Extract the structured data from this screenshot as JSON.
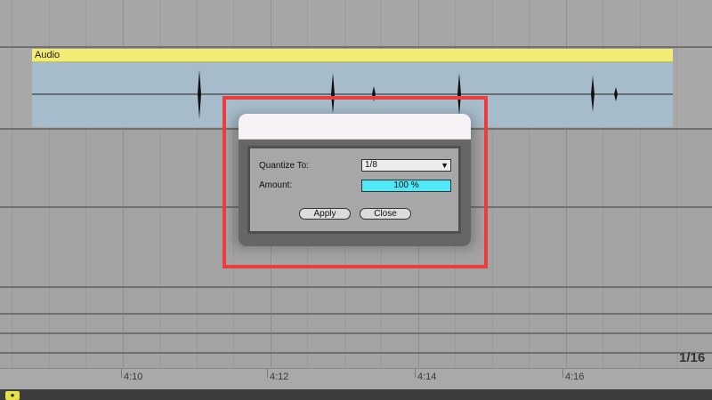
{
  "clip": {
    "name": "Audio",
    "color": "#f3ec74",
    "waveform_color": "#a6bccb"
  },
  "ruler": {
    "labels": [
      "4:10",
      "4:12",
      "4:14",
      "4:16"
    ],
    "grid_readout": "1/16"
  },
  "dialog": {
    "quantize_label": "Quantize To:",
    "quantize_value": "1/8",
    "caret": "▼",
    "amount_label": "Amount:",
    "amount_value": "100 %",
    "amount_color": "#4ee8f6",
    "apply_label": "Apply",
    "close_label": "Close"
  },
  "highlight_color": "#ee3b3b",
  "bottom": {
    "button_icon": "record-icon"
  }
}
